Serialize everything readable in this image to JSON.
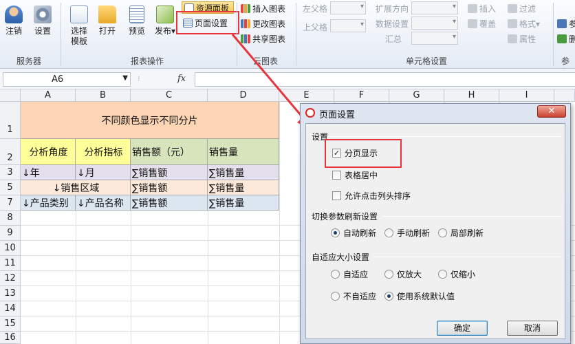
{
  "ribbon": {
    "groups": {
      "server": "服务器",
      "report_ops": "报表操作",
      "cloud_chart": "云图表",
      "cell_settings": "单元格设置",
      "params": "参数"
    },
    "buttons": {
      "logout": "注销",
      "settings": "设置",
      "select_template": "选择模板",
      "open": "打开",
      "preview": "预览",
      "publish": "发布",
      "resource_panel": "资源面板",
      "page_setup": "页面设置",
      "insert_chart": "插入图表",
      "change_chart": "更改图表",
      "share_chart": "共享图表",
      "left_parent": "左父格",
      "top_parent": "上父格",
      "expand_dir": "扩展方向",
      "data_setting": "数据设置",
      "summary": "汇总",
      "insert": "插入",
      "cover": "覆盖",
      "filter": "过滤",
      "format": "格式",
      "attribute": "属性",
      "param1": "参",
      "param2": "参",
      "param3": "删"
    }
  },
  "formula_bar": {
    "cell_ref": "A6",
    "fx": "fx",
    "formula": ""
  },
  "sheet": {
    "columns": [
      "A",
      "B",
      "C",
      "D",
      "E",
      "F",
      "G",
      "H",
      "I"
    ],
    "rows": [
      "1",
      "2",
      "3",
      "5",
      "7",
      "8",
      "9",
      "10",
      "11",
      "12",
      "13",
      "14",
      "15",
      "16"
    ],
    "cells": {
      "r1_title": "不同颜色显示不同分片",
      "r2_a": "分析角度",
      "r2_b": "分析指标",
      "r2_c": "销售额（元）",
      "r2_d": "销售量",
      "r3_a": "↓年",
      "r3_b": "↓月",
      "r3_c": "∑销售额",
      "r3_d": "∑销售量",
      "r5_ab": "↓销售区域",
      "r5_c": "∑销售额",
      "r5_d": "∑销售量",
      "r7_a": "↓产品类别",
      "r7_b": "↓产品名称",
      "r7_c": "∑销售额",
      "r7_d": "∑销售量"
    },
    "fill_colors": {
      "title": "#fcd5b4",
      "analysis_yellow": "#ffff99",
      "header_green": "#d8e4bc",
      "row3": "#e4dfec",
      "row5": "#fde9d9",
      "row7": "#dce6f1"
    }
  },
  "dialog": {
    "title": "页面设置",
    "close": "✕",
    "section_settings": "设置",
    "checkboxes": [
      {
        "label": "分页显示",
        "checked": true
      },
      {
        "label": "表格居中",
        "checked": false
      },
      {
        "label": "允许点击列头排序",
        "checked": false
      }
    ],
    "section_refresh": "切换参数刷新设置",
    "refresh_options": [
      {
        "label": "自动刷新",
        "selected": true
      },
      {
        "label": "手动刷新",
        "selected": false
      },
      {
        "label": "局部刷新",
        "selected": false
      }
    ],
    "section_autosize": "自适应大小设置",
    "autosize_options": [
      {
        "label": "自适应",
        "selected": false
      },
      {
        "label": "仅放大",
        "selected": false
      },
      {
        "label": "仅缩小",
        "selected": false
      },
      {
        "label": "不自适应",
        "selected": false
      },
      {
        "label": "使用系统默认值",
        "selected": true
      }
    ],
    "ok": "确定",
    "cancel": "取消"
  },
  "annotation_color": "#e8353d"
}
